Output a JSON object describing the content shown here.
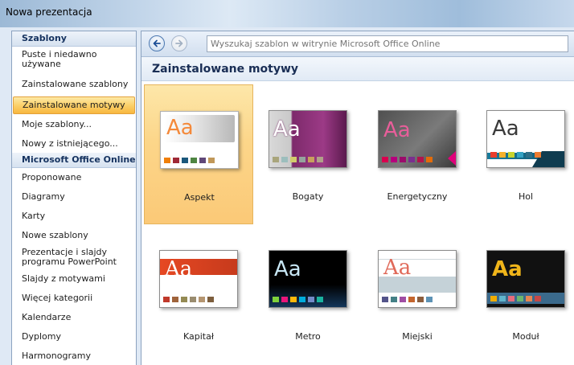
{
  "window": {
    "title": "Nowa prezentacja"
  },
  "sidebar": {
    "header_templates": "Szablony",
    "items_templates": [
      {
        "label": "Puste i niedawno używane",
        "selected": false
      },
      {
        "label": "Zainstalowane szablony",
        "selected": false
      },
      {
        "label": "Zainstalowane motywy",
        "selected": true
      },
      {
        "label": "Moje szablony...",
        "selected": false
      },
      {
        "label": "Nowy z istniejącego...",
        "selected": false
      }
    ],
    "header_online": "Microsoft Office Online",
    "items_online": [
      {
        "label": "Proponowane"
      },
      {
        "label": "Diagramy"
      },
      {
        "label": "Karty"
      },
      {
        "label": "Nowe szablony"
      },
      {
        "label": "Prezentacje i slajdy programu PowerPoint"
      },
      {
        "label": "Slajdy z motywami"
      },
      {
        "label": "Więcej kategorii"
      },
      {
        "label": "Kalendarze"
      },
      {
        "label": "Dyplomy"
      },
      {
        "label": "Harmonogramy"
      }
    ]
  },
  "toolbar": {
    "back_icon": "back-arrow-icon",
    "forward_icon": "forward-arrow-icon",
    "search_placeholder": "Wyszukaj szablon w witrynie Microsoft Office Online"
  },
  "section": {
    "title": "Zainstalowane motywy"
  },
  "themes": [
    {
      "name": "Aspekt",
      "sample": "Aa",
      "selected": true
    },
    {
      "name": "Bogaty",
      "sample": "Aa"
    },
    {
      "name": "Energetyczny",
      "sample": "Aa"
    },
    {
      "name": "Hol",
      "sample": "Aa"
    },
    {
      "name": "Kapitał",
      "sample": "Aa"
    },
    {
      "name": "Metro",
      "sample": "Aa"
    },
    {
      "name": "Miejski",
      "sample": "Aa"
    },
    {
      "name": "Moduł",
      "sample": "Aa"
    }
  ],
  "colors": {
    "selection": "#fbd06a",
    "header_text": "#15325f"
  }
}
